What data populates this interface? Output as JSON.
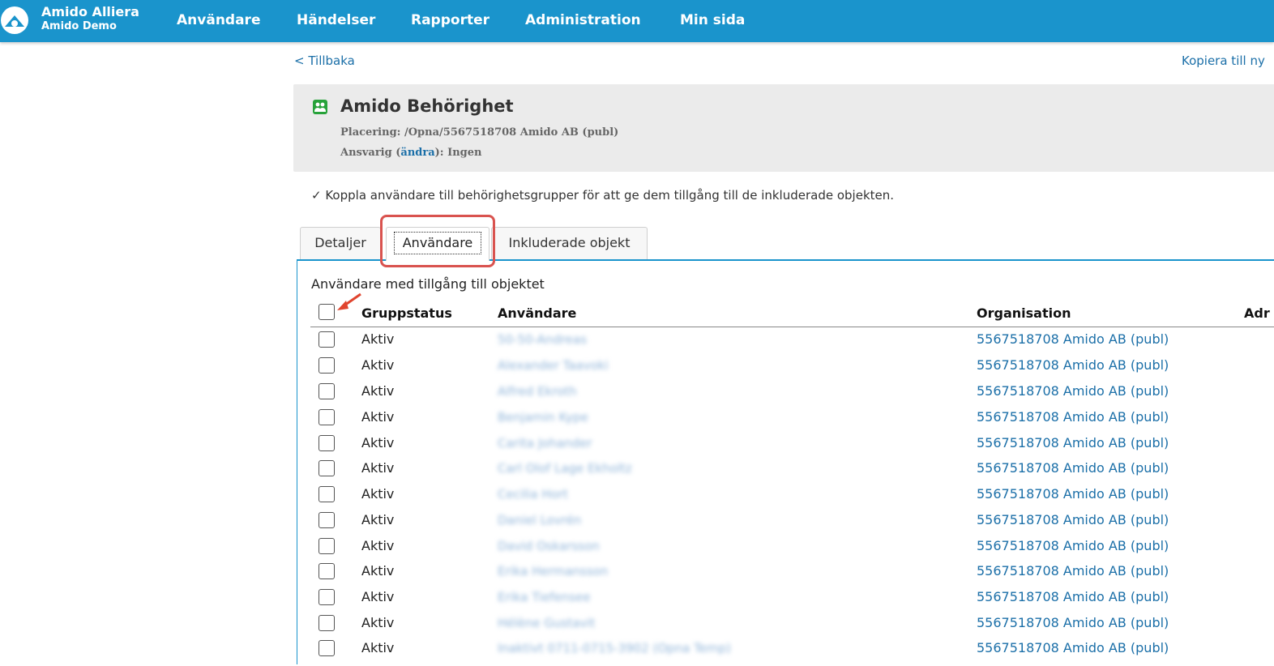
{
  "app": {
    "name": "Amido Alliera",
    "subtitle": "Amido Demo",
    "nav": [
      "Användare",
      "Händelser",
      "Rapporter",
      "Administration",
      "Min sida"
    ]
  },
  "links": {
    "back": "< Tillbaka",
    "copy": "Kopiera till ny"
  },
  "group": {
    "title": "Amido Behörighet",
    "placement_label": "Placering:",
    "placement_value": "/Opna/5567518708 Amido AB (publ)",
    "responsible_label": "Ansvarig (",
    "responsible_link": "ändra",
    "responsible_suffix": "): Ingen",
    "info": "✓ Koppla användare till behörighetsgrupper för att ge dem tillgång till de inkluderade objekten."
  },
  "tabs": [
    "Detaljer",
    "Användare",
    "Inkluderade objekt"
  ],
  "panel": {
    "caption": "Användare med tillgång till objektet",
    "columns": [
      "Gruppstatus",
      "Användare",
      "Organisation",
      "Adr"
    ]
  },
  "rows": [
    {
      "status": "Aktiv",
      "user": "50-50-Andreas",
      "org": "5567518708 Amido AB (publ)"
    },
    {
      "status": "Aktiv",
      "user": "Alexander Taavoki",
      "org": "5567518708 Amido AB (publ)"
    },
    {
      "status": "Aktiv",
      "user": "Alfred Ekroth",
      "org": "5567518708 Amido AB (publ)"
    },
    {
      "status": "Aktiv",
      "user": "Benjamin Kype",
      "org": "5567518708 Amido AB (publ)"
    },
    {
      "status": "Aktiv",
      "user": "Carita Johander",
      "org": "5567518708 Amido AB (publ)"
    },
    {
      "status": "Aktiv",
      "user": "Carl Olof Lage Ekholtz",
      "org": "5567518708 Amido AB (publ)"
    },
    {
      "status": "Aktiv",
      "user": "Cecilia Hort",
      "org": "5567518708 Amido AB (publ)"
    },
    {
      "status": "Aktiv",
      "user": "Daniel Lovrén",
      "org": "5567518708 Amido AB (publ)"
    },
    {
      "status": "Aktiv",
      "user": "David Oskarsson",
      "org": "5567518708 Amido AB (publ)"
    },
    {
      "status": "Aktiv",
      "user": "Erika Hermansson",
      "org": "5567518708 Amido AB (publ)"
    },
    {
      "status": "Aktiv",
      "user": "Erika Tiefensee",
      "org": "5567518708 Amido AB (publ)"
    },
    {
      "status": "Aktiv",
      "user": "Hélène Gustavit",
      "org": "5567518708 Amido AB (publ)"
    },
    {
      "status": "Aktiv",
      "user": "Inaktivt 0711-0715-3902 (Opna Temp)",
      "org": "5567518708 Amido AB (publ)"
    }
  ],
  "colors": {
    "topbar": "#1a94cc",
    "link": "#1b6fa8",
    "highlight": "#d9534f",
    "group_icon": "#27a23a"
  },
  "icons": {
    "logo": "alliera-logo-icon",
    "group": "group-icon",
    "annotation": "red-arrow-icon"
  }
}
